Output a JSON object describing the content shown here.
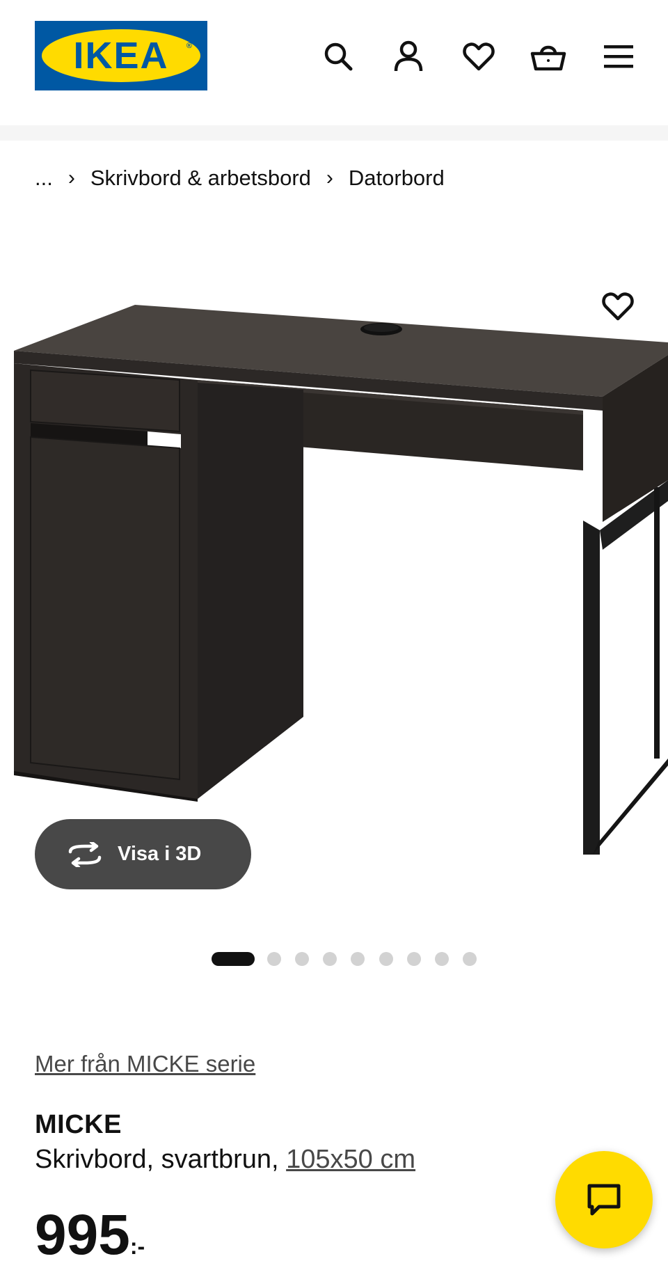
{
  "brand": {
    "logo_text": "IKEA",
    "registered": "®",
    "colors": {
      "blue": "#0058a3",
      "yellow": "#ffdb00"
    }
  },
  "header": {
    "icons": [
      "search-icon",
      "account-icon",
      "heart-icon",
      "basket-icon",
      "menu-icon"
    ]
  },
  "breadcrumb": {
    "ellipsis": "...",
    "separator": "›",
    "items": [
      "Skrivbord & arbetsbord",
      "Datorbord"
    ]
  },
  "gallery": {
    "view_3d_label": "Visa i 3D",
    "image_count": 9,
    "active_index": 0
  },
  "product": {
    "series_link": "Mer från MICKE serie",
    "name": "MICKE",
    "description": "Skrivbord, svartbrun,",
    "size": "105x50 cm",
    "price": "995",
    "price_suffix": ":-"
  },
  "chat": {
    "icon": "chat-icon"
  }
}
